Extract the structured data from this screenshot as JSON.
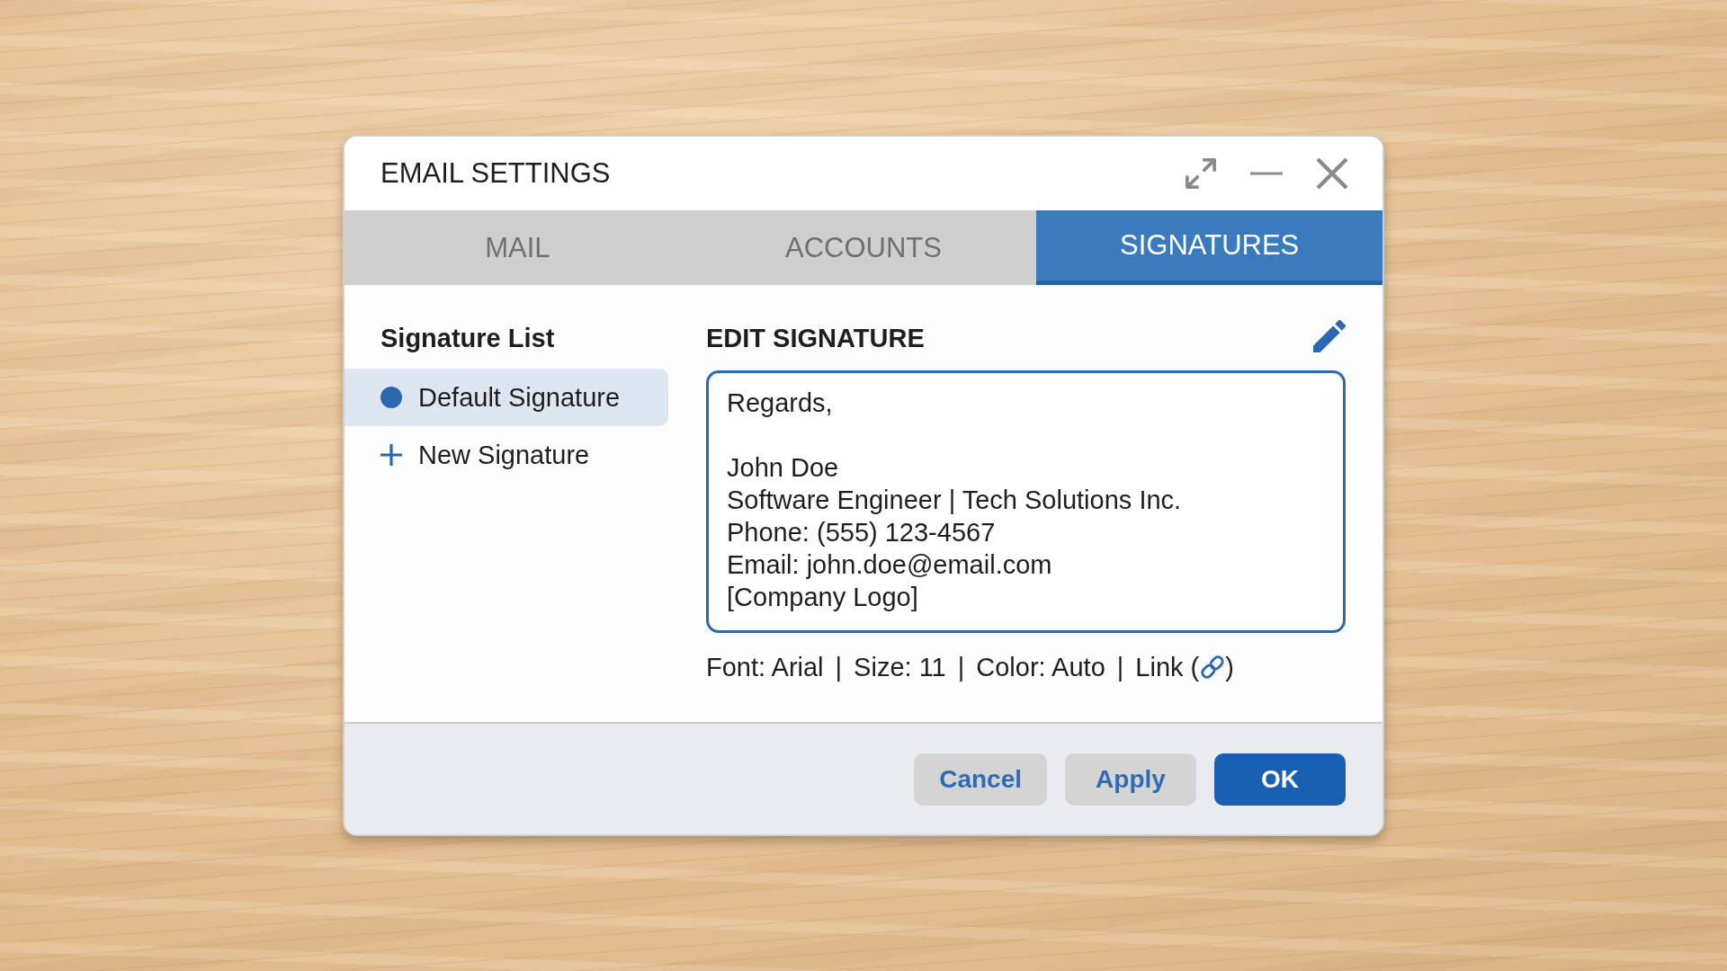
{
  "window": {
    "title": "EMAIL SETTINGS"
  },
  "tabs": [
    {
      "label": "MAIL",
      "selected": false
    },
    {
      "label": "ACCOUNTS",
      "selected": false
    },
    {
      "label": "SIGNATURES",
      "selected": true
    }
  ],
  "signature_list": {
    "title": "Signature List",
    "items": [
      {
        "kind": "signature",
        "label": "Default Signature",
        "selected": true
      },
      {
        "kind": "add",
        "label": "New Signature",
        "selected": false
      }
    ]
  },
  "editor": {
    "title": "EDIT SIGNATURE",
    "value": "Regards,\n\nJohn Doe\nSoftware Engineer | Tech Solutions Inc.\nPhone: (555) 123-4567\nEmail: john.doe@email.com\n[Company Logo]"
  },
  "format_bar": [
    {
      "kind": "text",
      "label": "Font: Arial"
    },
    {
      "kind": "separator",
      "label": "|"
    },
    {
      "kind": "text",
      "label": "Size: 11"
    },
    {
      "kind": "separator",
      "label": "|"
    },
    {
      "kind": "text",
      "label": "Color: Auto"
    },
    {
      "kind": "separator",
      "label": "|"
    },
    {
      "kind": "link",
      "label": "Link (",
      "closing": ")"
    }
  ],
  "buttons": [
    {
      "kind": "cancel",
      "label": "Cancel"
    },
    {
      "kind": "apply",
      "label": "Apply"
    },
    {
      "kind": "ok",
      "label": "OK"
    }
  ]
}
